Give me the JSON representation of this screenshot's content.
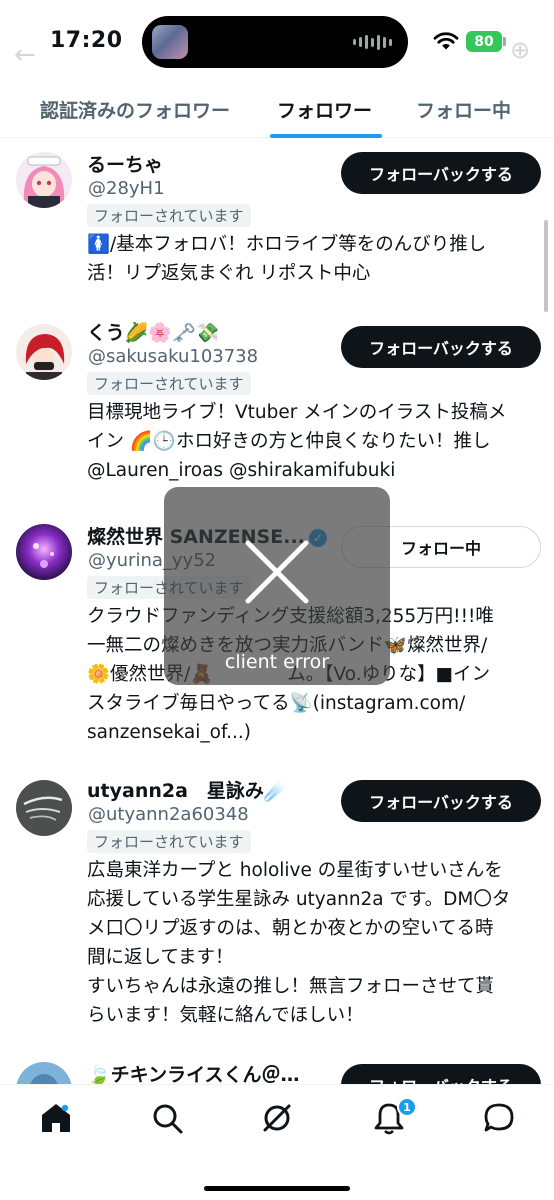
{
  "status_bar": {
    "time": "17:20",
    "battery": "80"
  },
  "tabs": [
    {
      "label": "認証済みのフォロワー",
      "active": false
    },
    {
      "label": "フォロワー",
      "active": true
    },
    {
      "label": "フォロー中",
      "active": false
    }
  ],
  "users": [
    {
      "name": "るーちゃ",
      "handle": "@28yH1",
      "follows_you": "フォローされています",
      "button": "フォローバックする",
      "bio": "🚺/基本フォロバ！ホロライブ等をのんびり推し\n活！リプ返気まぐれ リポスト中心"
    },
    {
      "name": "くう",
      "name_emoji": "🌽🌸🗝️💸",
      "handle": "@sakusaku103738",
      "follows_you": "フォローされています",
      "button": "フォローバックする",
      "bio": "目標現地ライブ！Vtuber メインのイラスト投稿メ\nイン 🌈🕒ホロ好きの方と仲良くなりたい！推し\n@Lauren_iroas @shirakamifubuki"
    },
    {
      "name": "燦然世界 SANZENSE...",
      "verified": true,
      "handle": "@yurina_yy52",
      "follows_you": "フォローされています",
      "button": "フォロー中",
      "bio": "クラウドファンディング支援総額3,255万円!!!唯\n一無二の燦めきを放つ実力派バンド🦋燦然世界/\n🌼優然世界/🧸　　　　ム。【Vo.ゆりな】■イン\nスタライブ毎日やってる📡(instagram.com/\nsanzensekai_of...)"
    },
    {
      "name": "utyann2a　星詠み",
      "name_emoji": "☄️",
      "handle": "@utyann2a60348",
      "follows_you": "フォローされています",
      "button": "フォローバックする",
      "bio": "広島東洋カープと hololive の星街すいせいさんを\n応援している学生星詠み utyann2a です。DM〇タ\nメ口〇リプ返すのは、朝とか夜とかの空いてる時\n間に返してます！\nすいちゃんは永遠の推し！無言フォローさせて貰\nらいます！気軽に絡んでほしい！"
    },
    {
      "name": "🍃チキンライスくん＠…",
      "button": "フォローバックする"
    }
  ],
  "error": {
    "text": "client error"
  },
  "bottom_nav": {
    "items": [
      "home-icon",
      "search-icon",
      "grok-icon",
      "notifications-icon",
      "messages-icon"
    ],
    "notification_count": "1"
  },
  "colors": {
    "accent": "#1d9bf0",
    "text": "#0f1419",
    "muted": "#536471"
  }
}
